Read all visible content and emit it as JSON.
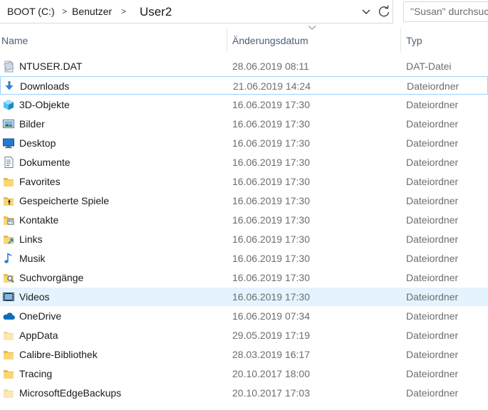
{
  "address_bar": {
    "crumbs": [
      "BOOT (C:)",
      "Benutzer",
      "User2"
    ],
    "separator": ">",
    "dropdown_icon": "chevron-down-icon",
    "refresh_icon": "refresh-icon"
  },
  "search": {
    "placeholder": "\"Susan\" durchsuchen"
  },
  "columns": {
    "name": "Name",
    "date": "Änderungsdatum",
    "type": "Typ"
  },
  "rows": [
    {
      "name": "NTUSER.DAT",
      "date": "28.06.2019 08:11",
      "type": "DAT-Datei",
      "icon": "dat-file-icon"
    },
    {
      "name": "Downloads",
      "date": "21.06.2019 14:24",
      "type": "Dateiordner",
      "icon": "downloads-folder-icon"
    },
    {
      "name": "3D-Objekte",
      "date": "16.06.2019 17:30",
      "type": "Dateiordner",
      "icon": "3d-objects-icon"
    },
    {
      "name": "Bilder",
      "date": "16.06.2019 17:30",
      "type": "Dateiordner",
      "icon": "pictures-folder-icon"
    },
    {
      "name": "Desktop",
      "date": "16.06.2019 17:30",
      "type": "Dateiordner",
      "icon": "desktop-folder-icon"
    },
    {
      "name": "Dokumente",
      "date": "16.06.2019 17:30",
      "type": "Dateiordner",
      "icon": "documents-folder-icon"
    },
    {
      "name": "Favorites",
      "date": "16.06.2019 17:30",
      "type": "Dateiordner",
      "icon": "folder-icon"
    },
    {
      "name": "Gespeicherte Spiele",
      "date": "16.06.2019 17:30",
      "type": "Dateiordner",
      "icon": "saved-games-folder-icon"
    },
    {
      "name": "Kontakte",
      "date": "16.06.2019 17:30",
      "type": "Dateiordner",
      "icon": "contacts-folder-icon"
    },
    {
      "name": "Links",
      "date": "16.06.2019 17:30",
      "type": "Dateiordner",
      "icon": "links-folder-icon"
    },
    {
      "name": "Musik",
      "date": "16.06.2019 17:30",
      "type": "Dateiordner",
      "icon": "music-folder-icon"
    },
    {
      "name": "Suchvorgänge",
      "date": "16.06.2019 17:30",
      "type": "Dateiordner",
      "icon": "searches-folder-icon"
    },
    {
      "name": "Videos",
      "date": "16.06.2019 17:30",
      "type": "Dateiordner",
      "icon": "videos-folder-icon"
    },
    {
      "name": "OneDrive",
      "date": "16.06.2019 07:34",
      "type": "Dateiordner",
      "icon": "onedrive-icon"
    },
    {
      "name": "AppData",
      "date": "29.05.2019 17:19",
      "type": "Dateiordner",
      "icon": "hidden-folder-icon"
    },
    {
      "name": "Calibre-Bibliothek",
      "date": "28.03.2019 16:17",
      "type": "Dateiordner",
      "icon": "folder-icon"
    },
    {
      "name": "Tracing",
      "date": "20.10.2017 18:00",
      "type": "Dateiordner",
      "icon": "folder-icon"
    },
    {
      "name": "MicrosoftEdgeBackups",
      "date": "20.10.2017 17:03",
      "type": "Dateiordner",
      "icon": "hidden-folder-icon"
    }
  ],
  "focused_row": "Downloads",
  "hovered_row": "Videos",
  "colors": {
    "header_text": "#4c607a",
    "secondary_text": "#6d6d6d",
    "hover_bg": "#e5f3ff",
    "focus_border": "#99d1ff",
    "folder_yellow": "#f8d775"
  }
}
